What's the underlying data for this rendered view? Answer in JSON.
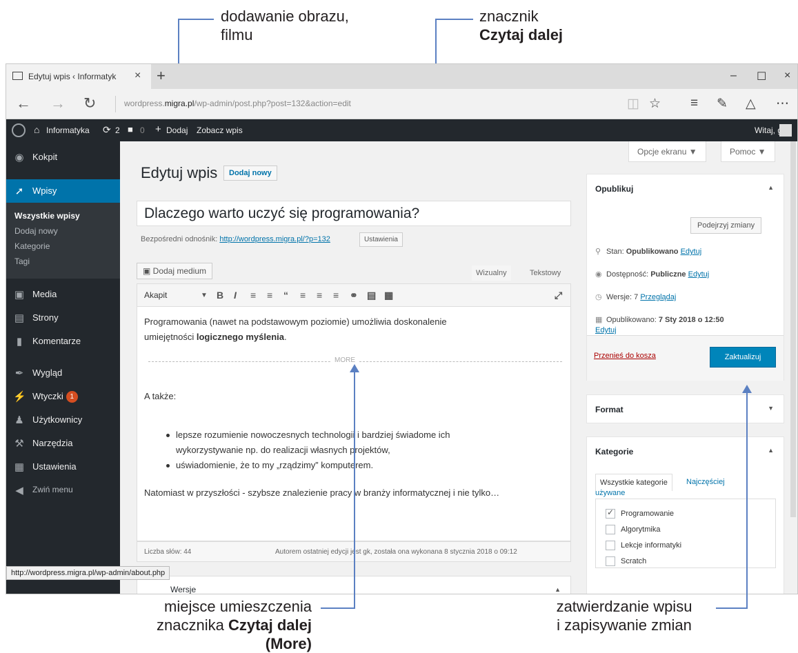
{
  "annotations": {
    "top_left_line1": "dodawanie obrazu,",
    "top_left_line2": "filmu",
    "top_right_line1": "znacznik",
    "top_right_line2": "Czytaj dalej",
    "bottom_left_line1": "miejsce umieszczenia",
    "bottom_left_line2a": "znacznika ",
    "bottom_left_line2b": "Czytaj dalej",
    "bottom_left_line2c": " (More)",
    "bottom_right_line1": "zatwierdzanie wpisu",
    "bottom_right_line2": "i zapisywanie zmian"
  },
  "browser": {
    "tab_title": "Edytuj wpis ‹ Informatyk",
    "tab_close": "×",
    "new_tab": "+",
    "minimize": "–",
    "maximize": "☐",
    "close": "×",
    "back": "←",
    "forward": "→",
    "refresh": "↻",
    "url_host": "wordpress.",
    "url_bold": "migra.pl",
    "url_path": "/wp-admin/post.php?post=132&action=edit",
    "status_url": "http://wordpress.migra.pl/wp-admin/about.php"
  },
  "adminbar": {
    "site_name": "Informatyka",
    "updates_count": "2",
    "comments_count": "0",
    "add_label": "Dodaj",
    "view_post": "Zobacz wpis",
    "greeting": "Witaj, gk"
  },
  "sidebar": {
    "dashboard": "Kokpit",
    "posts": "Wpisy",
    "sub_all": "Wszystkie wpisy",
    "sub_add": "Dodaj nowy",
    "sub_categories": "Kategorie",
    "sub_tags": "Tagi",
    "media": "Media",
    "pages": "Strony",
    "comments": "Komentarze",
    "appearance": "Wygląd",
    "plugins": "Wtyczki",
    "plugins_badge": "1",
    "users": "Użytkownicy",
    "tools": "Narzędzia",
    "settings": "Ustawienia",
    "collapse": "Zwiń menu"
  },
  "header": {
    "screen_options": "Opcje ekranu ▼",
    "help": "Pomoc ▼",
    "page_title": "Edytuj wpis",
    "add_new": "Dodaj nowy"
  },
  "editor": {
    "post_title": "Dlaczego warto uczyć się programowania?",
    "permalink_label": "Bezpośredni odnośnik:",
    "permalink_url": "http://wordpress.migra.pl/?p=132",
    "permalink_btn": "Ustawienia",
    "add_media": "Dodaj medium",
    "tab_visual": "Wizualny",
    "tab_text": "Tekstowy",
    "format": "Akapit",
    "para1_line1": "Programowania (nawet na podstawowym poziomie) umożliwia doskonalenie",
    "para1_line2a": "umiejętności ",
    "para1_line2b": "logicznego myślenia",
    "para1_line2c": ".",
    "more": "MORE",
    "also": "A także:",
    "bullet1_line1": "lepsze rozumienie nowoczesnych technologii i bardziej świadome ich",
    "bullet1_line2": "wykorzystywanie np. do realizacji własnych projektów,",
    "bullet2": "uświadomienie, że to my „rządzimy” komputerem.",
    "para2": "Natomiast w przyszłości - szybsze znalezienie pracy w branży informatycznej i nie tylko…",
    "word_count": "Liczba słów: 44",
    "last_edit": "Autorem ostatniej edycji jest gk, została ona wykonana 8 stycznia 2018 o 09:12",
    "below_box": "Wersje"
  },
  "publish": {
    "title": "Opublikuj",
    "preview_changes": "Podejrzyj zmiany",
    "status_label": "Stan: ",
    "status_value": "Opublikowano",
    "edit": "Edytuj",
    "visibility_label": "Dostępność: ",
    "visibility_value": "Publiczne",
    "revisions_label": "Wersje: ",
    "revisions_value": "7",
    "revisions_link": "Przeglądaj",
    "published_label": "Opublikowano: ",
    "published_value": "7 Sty 2018 o 12:50",
    "trash": "Przenieś do kosza",
    "update": "Zaktualizuj"
  },
  "format_box": {
    "title": "Format"
  },
  "categories": {
    "title": "Kategorie",
    "tab_all": "Wszystkie kategorie",
    "tab_popular_line1": "Najczęściej",
    "tab_popular_line2": "używane",
    "items": [
      {
        "label": "Programowanie",
        "checked": true
      },
      {
        "label": "Algorytmika",
        "checked": false
      },
      {
        "label": "Lekcje informatyki",
        "checked": false
      },
      {
        "label": "Scratch",
        "checked": false
      }
    ]
  },
  "colors": {
    "accent": "#0073aa",
    "admin_bar": "#23282d",
    "annotation_line": "#5b80c2",
    "update_button": "#0085ba"
  }
}
